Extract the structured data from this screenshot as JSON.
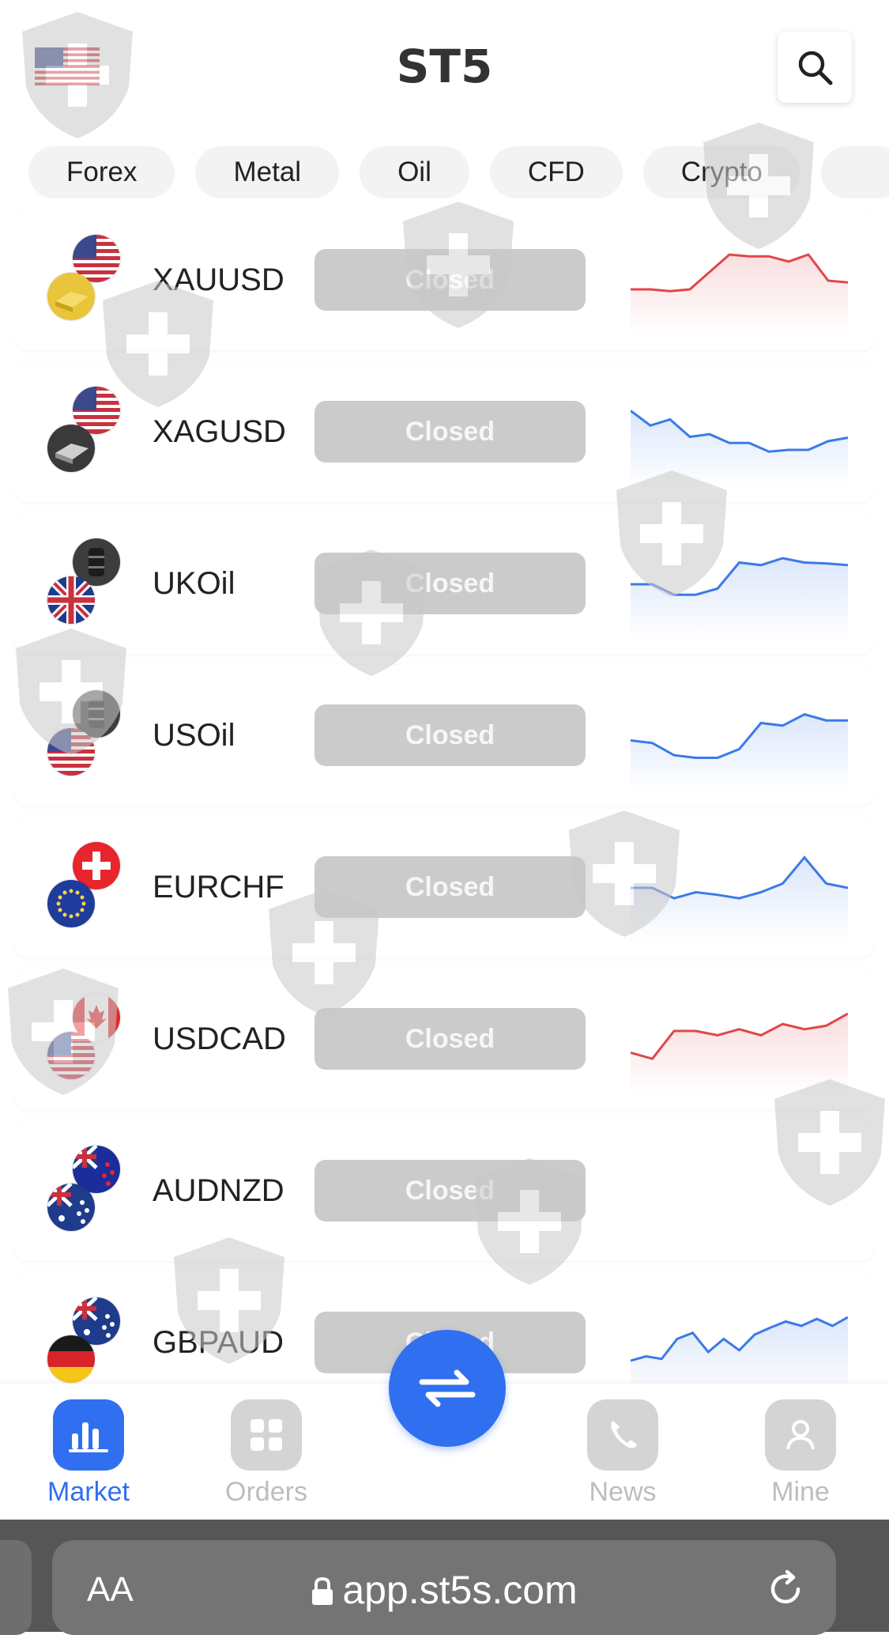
{
  "header": {
    "title": "ST5",
    "flag_icon": "us-flag-icon",
    "search_icon": "search-icon"
  },
  "tabs": [
    "Forex",
    "Metal",
    "Oil",
    "CFD",
    "Crypto"
  ],
  "market_rows": [
    {
      "symbol": "XAUUSD",
      "status": "Closed",
      "icons": [
        "us-flag",
        "gold-bar"
      ],
      "trend_color": "#e0464b",
      "spark": [
        40,
        40,
        38,
        40,
        60,
        80,
        78,
        78,
        72,
        80,
        50,
        48
      ]
    },
    {
      "symbol": "XAGUSD",
      "status": "Closed",
      "icons": [
        "us-flag",
        "silver-bar"
      ],
      "trend_color": "#3b7ae8",
      "spark": [
        75,
        58,
        65,
        45,
        48,
        38,
        38,
        28,
        30,
        30,
        40,
        44
      ]
    },
    {
      "symbol": "UKOil",
      "status": "Closed",
      "icons": [
        "oil-barrel",
        "uk-flag"
      ],
      "trend_color": "#3b7ae8",
      "spark": [
        50,
        50,
        38,
        38,
        45,
        75,
        72,
        80,
        75,
        74,
        72
      ]
    },
    {
      "symbol": "USOil",
      "status": "Closed",
      "icons": [
        "oil-barrel",
        "us-flag"
      ],
      "trend_color": "#3b7ae8",
      "spark": [
        45,
        42,
        28,
        25,
        25,
        35,
        65,
        62,
        75,
        68,
        68
      ]
    },
    {
      "symbol": "EURCHF",
      "status": "Closed",
      "icons": [
        "swiss-flag",
        "eu-flag"
      ],
      "trend_color": "#3b7ae8",
      "spark": [
        50,
        50,
        38,
        45,
        42,
        38,
        45,
        55,
        85,
        55,
        50
      ]
    },
    {
      "symbol": "USDCAD",
      "status": "Closed",
      "icons": [
        "canada-flag",
        "us-flag"
      ],
      "trend_color": "#e0464b",
      "spark": [
        35,
        28,
        60,
        60,
        55,
        62,
        55,
        68,
        62,
        66,
        80
      ]
    },
    {
      "symbol": "AUDNZD",
      "status": "Closed",
      "icons": [
        "nz-flag",
        "au-flag"
      ],
      "trend_color": "#3b7ae8",
      "spark": []
    },
    {
      "symbol": "GBPAUD",
      "status": "Closed",
      "icons": [
        "au-flag",
        "germany-flag"
      ],
      "trend_color": "#3b7ae8",
      "spark": [
        30,
        35,
        32,
        55,
        62,
        40,
        55,
        42,
        60,
        68,
        75,
        70,
        78,
        70,
        80
      ]
    }
  ],
  "bottom_nav": [
    {
      "label": "Market",
      "icon": "bar-chart-icon",
      "active": true
    },
    {
      "label": "Orders",
      "icon": "grid-icon",
      "active": false
    },
    {
      "label": "News",
      "icon": "phone-icon",
      "active": false
    },
    {
      "label": "Mine",
      "icon": "user-icon",
      "active": false
    }
  ],
  "fab_icon": "swap-arrows-icon",
  "browser": {
    "text_size_label": "AA",
    "url": "app.st5s.com",
    "reload_icon": "reload-icon",
    "lock_icon": "lock-icon"
  }
}
